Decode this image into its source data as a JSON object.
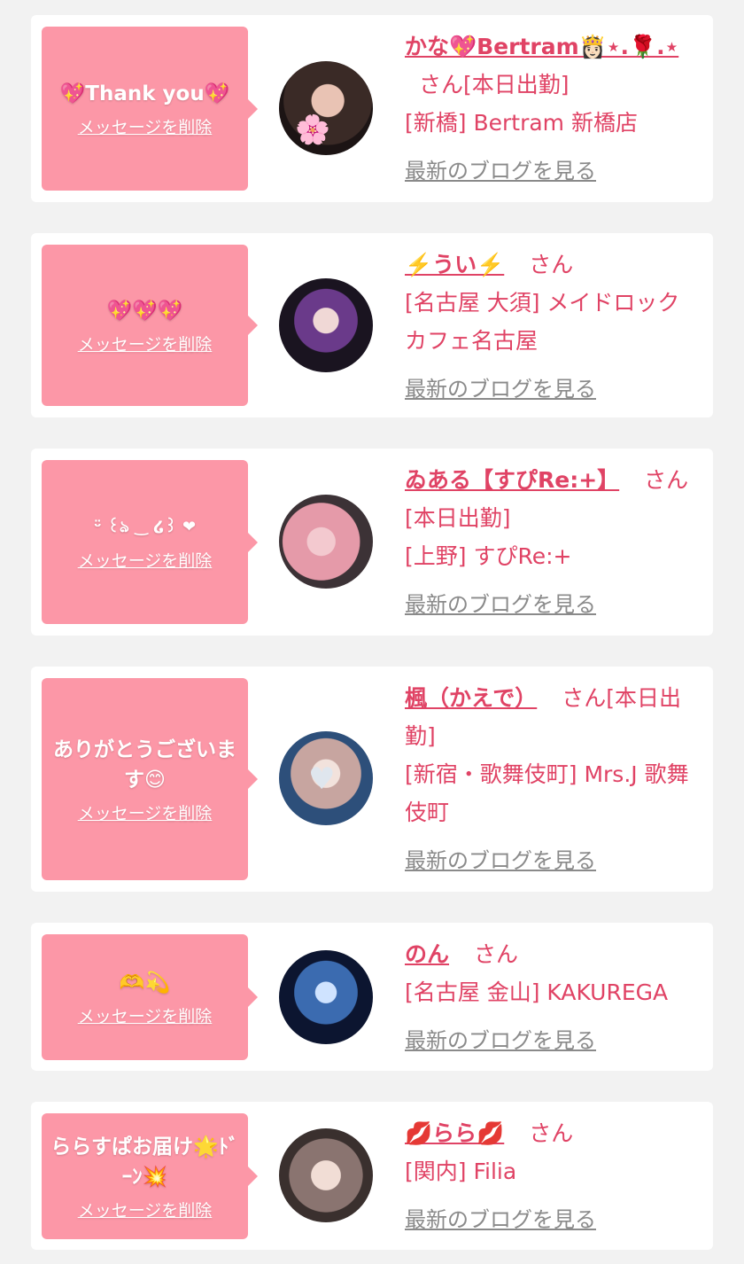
{
  "delete_label": "メッセージを削除",
  "blog_label": "最新のブログを見る",
  "san": "さん",
  "colors": {
    "bubble": "#fc97a7",
    "name": "#e04365",
    "blog": "#8a8a8a",
    "background": "#f2f2f2"
  },
  "cards": [
    {
      "message": "💖Thank you💖",
      "name": "かな💖Bertram👸🏻⋆.🌹.⋆",
      "status": "[本日出勤]",
      "shop": "[新橋] Bertram 新橋店"
    },
    {
      "message": "💖💖💖",
      "name": "⚡️うい⚡️",
      "status": "",
      "shop": "[名古屋 大須] メイドロックカフェ名古屋"
    },
    {
      "message": "ᵕ̈ ꒰ঌ ‿ ໒꒱ ❤︎",
      "name": "ゐある【すぴRe:+】",
      "status": "[本日出勤]",
      "shop": "[上野] すぴRe:+"
    },
    {
      "message": "ありがとうございます😊",
      "name": "楓（かえで）",
      "status": "[本日出勤]",
      "shop": "[新宿・歌舞伎町] Mrs.J 歌舞伎町"
    },
    {
      "message": "🫶💫",
      "name": "のん",
      "status": "",
      "shop": "[名古屋 金山] KAKUREGA"
    },
    {
      "message": "ららすぱお届け🌟ﾄﾞｰﾝ💥",
      "name": "💋らら💋",
      "status": "",
      "shop": "[関内] Filia"
    }
  ]
}
